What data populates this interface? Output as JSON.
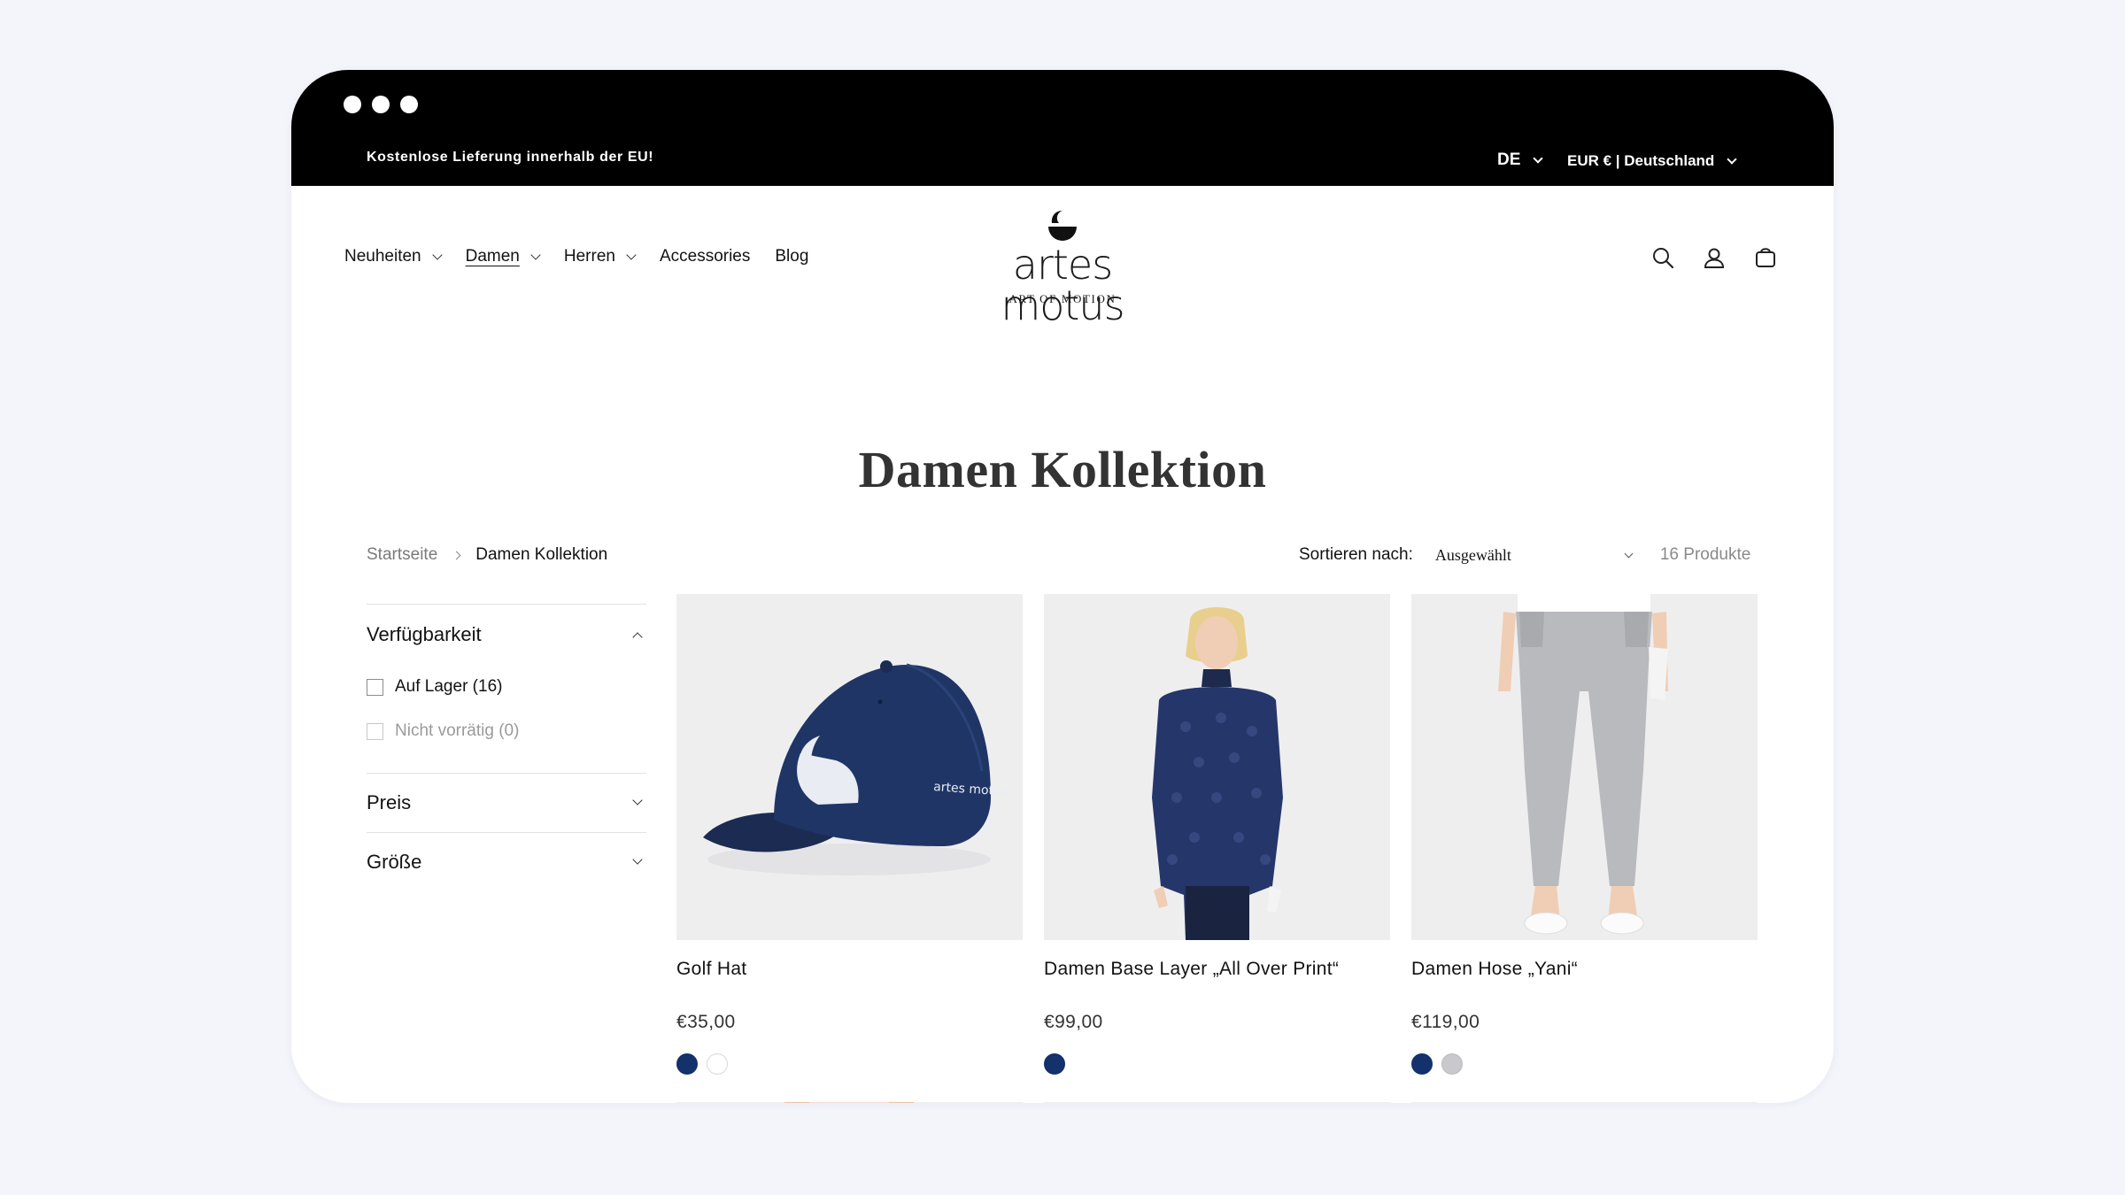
{
  "topbar": {
    "announcement": "Kostenlose Lieferung innerhalb der EU!",
    "language": "DE",
    "currency": "EUR € | Deutschland"
  },
  "nav": {
    "items": [
      {
        "label": "Neuheiten",
        "has_dropdown": true,
        "active": false
      },
      {
        "label": "Damen",
        "has_dropdown": true,
        "active": true
      },
      {
        "label": "Herren",
        "has_dropdown": true,
        "active": false
      },
      {
        "label": "Accessories",
        "has_dropdown": false,
        "active": false
      },
      {
        "label": "Blog",
        "has_dropdown": false,
        "active": false
      }
    ]
  },
  "logo": {
    "name": "artes motus",
    "tagline": "ART OF MOTION"
  },
  "header_icons": [
    "search-icon",
    "account-icon",
    "cart-icon"
  ],
  "page": {
    "title": "Damen Kollektion"
  },
  "breadcrumb": {
    "home": "Startseite",
    "current": "Damen Kollektion"
  },
  "sort": {
    "label": "Sortieren nach:",
    "selected": "Ausgewählt",
    "product_count": "16 Produkte"
  },
  "filters": {
    "availability": {
      "title": "Verfügbarkeit",
      "options": [
        {
          "label": "Auf Lager (16)",
          "enabled": true
        },
        {
          "label": "Nicht vorrätig (0)",
          "enabled": false
        }
      ]
    },
    "price": {
      "title": "Preis"
    },
    "size": {
      "title": "Größe"
    }
  },
  "products": [
    {
      "title": "Golf Hat",
      "price": "€35,00",
      "swatches": [
        "navy",
        "white"
      ],
      "cap_text": "artes motus"
    },
    {
      "title": "Damen Base Layer „All Over Print“",
      "price": "€99,00",
      "swatches": [
        "navy"
      ]
    },
    {
      "title": "Damen Hose „Yani“",
      "price": "€119,00",
      "swatches": [
        "navy",
        "grey"
      ]
    }
  ],
  "colors": {
    "navy": "#13316a",
    "grey": "#c9c9cd",
    "topbar": "#000000",
    "image_bg": "#efeeef"
  }
}
